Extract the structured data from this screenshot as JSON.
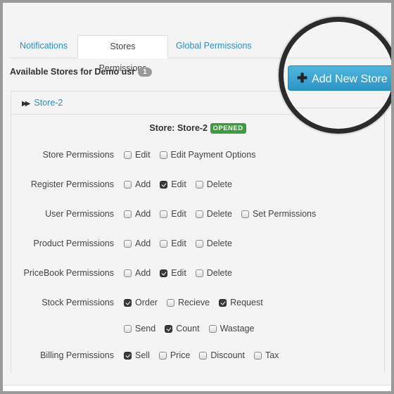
{
  "tabs": [
    {
      "label": "Notifications",
      "active": false
    },
    {
      "label": "Stores Permissions",
      "active": true
    },
    {
      "label": "Global Permissions",
      "active": false
    }
  ],
  "available_stores": {
    "label": "Available Stores for Demo usr",
    "count": "1"
  },
  "add_store_button": {
    "label": "Add New Store",
    "icon": "plus-icon",
    "color": "#2b95c7"
  },
  "store_panel": {
    "name": "Store-2",
    "icon": "fast-forward-icon",
    "title": "Store: Store-2",
    "status": "OPENED",
    "status_color": "#3f9a3f",
    "permissions": [
      {
        "label": "Store Permissions",
        "options": [
          {
            "label": "Edit",
            "checked": false
          },
          {
            "label": "Edit Payment Options",
            "checked": false
          }
        ]
      },
      {
        "label": "Register Permissions",
        "options": [
          {
            "label": "Add",
            "checked": false
          },
          {
            "label": "Edit",
            "checked": true
          },
          {
            "label": "Delete",
            "checked": false
          }
        ]
      },
      {
        "label": "User Permissions",
        "options": [
          {
            "label": "Add",
            "checked": false
          },
          {
            "label": "Edit",
            "checked": false
          },
          {
            "label": "Delete",
            "checked": false
          },
          {
            "label": "Set Permissions",
            "checked": false
          }
        ]
      },
      {
        "label": "Product Permissions",
        "options": [
          {
            "label": "Add",
            "checked": false
          },
          {
            "label": "Edit",
            "checked": false
          },
          {
            "label": "Delete",
            "checked": false
          }
        ]
      },
      {
        "label": "PriceBook Permissions",
        "options": [
          {
            "label": "Add",
            "checked": false
          },
          {
            "label": "Edit",
            "checked": true
          },
          {
            "label": "Delete",
            "checked": false
          }
        ]
      },
      {
        "label": "Stock Permissions",
        "options": [
          {
            "label": "Order",
            "checked": true
          },
          {
            "label": "Recieve",
            "checked": false
          },
          {
            "label": "Request",
            "checked": true
          }
        ]
      },
      {
        "label": "",
        "options": [
          {
            "label": "Send",
            "checked": false
          },
          {
            "label": "Count",
            "checked": true
          },
          {
            "label": "Wastage",
            "checked": false
          }
        ]
      },
      {
        "label": "Billing Permissions",
        "options": [
          {
            "label": "Sell",
            "checked": true
          },
          {
            "label": "Price",
            "checked": false
          },
          {
            "label": "Discount",
            "checked": false
          },
          {
            "label": "Tax",
            "checked": false
          }
        ]
      }
    ]
  }
}
